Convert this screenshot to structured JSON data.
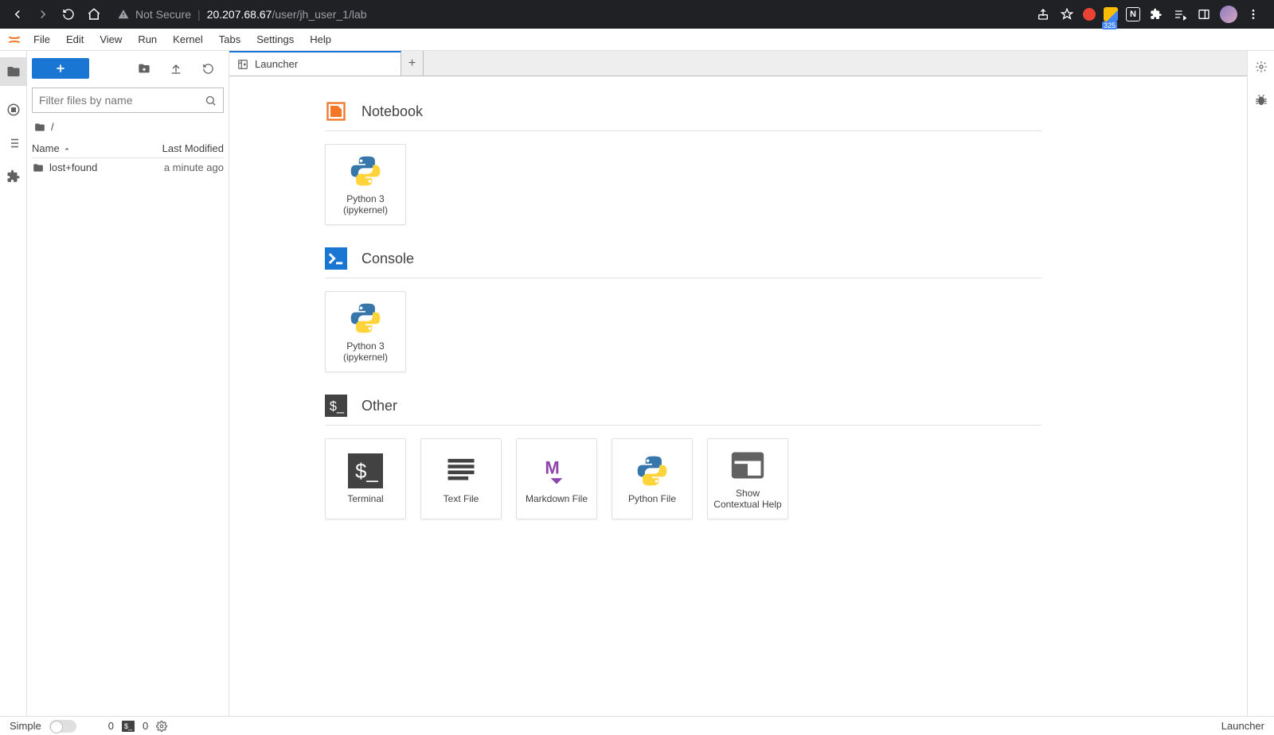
{
  "browser": {
    "insecure_label": "Not Secure",
    "url_host": "20.207.68.67",
    "url_path": "/user/jh_user_1/lab",
    "badge_num": "325"
  },
  "menu": {
    "items": [
      "File",
      "Edit",
      "View",
      "Run",
      "Kernel",
      "Tabs",
      "Settings",
      "Help"
    ]
  },
  "filebrowser": {
    "filter_placeholder": "Filter files by name",
    "breadcrumb": "/",
    "header_name": "Name",
    "header_modified": "Last Modified",
    "rows": [
      {
        "name": "lost+found",
        "modified": "a minute ago"
      }
    ]
  },
  "tabs": {
    "active": "Launcher"
  },
  "launcher": {
    "sections": {
      "notebook": {
        "title": "Notebook",
        "card": "Python 3\n(ipykernel)"
      },
      "console": {
        "title": "Console",
        "card": "Python 3\n(ipykernel)"
      },
      "other": {
        "title": "Other",
        "cards": [
          "Terminal",
          "Text File",
          "Markdown File",
          "Python File",
          "Show\nContextual Help"
        ]
      }
    }
  },
  "statusbar": {
    "simple": "Simple",
    "count1": "0",
    "count2": "0",
    "right": "Launcher"
  }
}
